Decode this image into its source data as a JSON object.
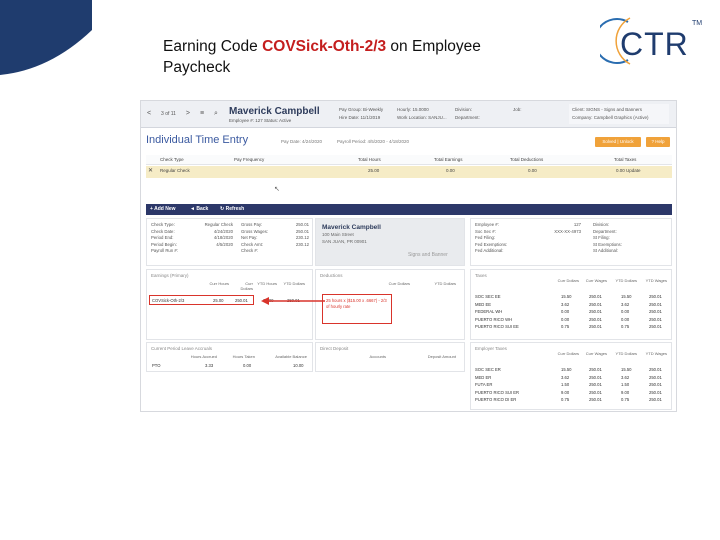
{
  "slide": {
    "title_prefix": "Earning Code ",
    "title_code": "COVSick-Oth-2/3",
    "title_suffix": " on Employee",
    "title_line2": "Paycheck"
  },
  "logo": {
    "text": "CTR",
    "tm": "TM"
  },
  "app": {
    "nav": {
      "prev": "<",
      "count": "3 of 11",
      "next": ">",
      "list": "≡",
      "search": "⌕"
    },
    "employee_name": "Maverick Campbell",
    "employee_sub": "Employee #: 127   Status: Active",
    "info_col1": [
      "Pay Group: Bi-Weekly",
      "Hire Date: 11/1/2019"
    ],
    "info_col2": [
      "Hourly: 15.0000",
      "Work Location: SANJU..."
    ],
    "info_col3": [
      "Division:",
      "Department:"
    ],
    "info_col4": [
      "Job:"
    ],
    "client": [
      "Client: SIGNS - Signs and Banners",
      "Company: Campbell Graphics (Active)"
    ],
    "heading": "Individual Time Entry",
    "pay_date": "Pay Date: 4/24/2020",
    "pay_period": "Payroll Period: 4/5/2020 - 4/18/2020",
    "btn_solved": "Solved | Unlock",
    "btn_help": "? Help",
    "grid_headers": [
      "Check Type",
      "Pay Frequency",
      "Total Hours",
      "Total Earnings",
      "Total Deductions",
      "Total Taxes"
    ],
    "grid_row": [
      "Regular Check",
      "",
      "25.00",
      "0.00",
      "0.00",
      "0.00  Update"
    ],
    "toolbar": [
      "+ Add New",
      "◄ Back",
      "↻ Refresh"
    ],
    "check_info_left": [
      "Check Type:",
      "Check Date:",
      "Period End:",
      "Period Begin:",
      "Payroll Run #:"
    ],
    "check_info_left_vals": [
      "Regular Check",
      "4/24/2020",
      "4/18/2020",
      "4/5/2020",
      ""
    ],
    "check_info_mid": [
      "Gross Pay:",
      "Gross Wages:",
      "Net Pay:",
      "Check Amt:",
      "Check #:"
    ],
    "check_info_mid_vals": [
      "250.01",
      "250.01",
      "230.12",
      "230.12",
      ""
    ],
    "addr_name": "Maverick Campbell",
    "addr_lines": [
      "100 Main Street",
      "SAN JUAN, PR 00901"
    ],
    "addr_banner": "Signs and Banner",
    "emp_labels": [
      "Employee #:",
      "Soc Sec #:",
      "Fed Filing:",
      "Fed Exemptions:",
      "Fed Additional:"
    ],
    "emp_vals": [
      "127",
      "XXX-XX-4973",
      "",
      "",
      ""
    ],
    "emp_labels2": [
      "Division:",
      "Department:",
      "St Filing:",
      "St Exemptions:",
      "St Additional:"
    ],
    "earn_title": "Earnings (Primary)",
    "earn_cols": [
      "Curr Hours",
      "Curr Dollars",
      "YTD Hours",
      "YTD Dollars"
    ],
    "earn_row": [
      "COVSick-Oth-2/3",
      "25.00",
      "250.01",
      "25.00",
      "250.01"
    ],
    "ded_title": "Deductions",
    "ded_cols": [
      "Curr Dollars",
      "YTD Dollars"
    ],
    "callout": "25 hours x ($15.00 x .6667) - 2/3 of hourly rate",
    "tax_title": "Taxes",
    "tax_cols": [
      "Curr Dollars",
      "Curr Wages",
      "YTD Dollars",
      "YTD Wages"
    ],
    "tax_rows": [
      [
        "SOC SEC EE",
        "15.50",
        "250.01",
        "15.50",
        "250.01"
      ],
      [
        "MED EE",
        "3.62",
        "250.01",
        "3.62",
        "250.01"
      ],
      [
        "FEDERAL WH",
        "0.00",
        "250.01",
        "0.00",
        "250.01"
      ],
      [
        "PUERTO RICO WH",
        "0.00",
        "250.01",
        "0.00",
        "250.01"
      ],
      [
        "PUERTO RICO SUI EE",
        "0.75",
        "250.01",
        "0.75",
        "250.01"
      ]
    ],
    "leave_title": "Current Period Leave Accruals",
    "leave_cols": [
      "Hours Accrued",
      "Hours Taken",
      "Available Balance"
    ],
    "leave_row": [
      "PTO",
      "3.33",
      "0.00",
      "10.00"
    ],
    "direct_title": "Direct Deposit",
    "direct_cols": [
      "Accounts",
      "Deposit Amount"
    ],
    "emptax_title": "Employer Taxes",
    "emptax_cols": [
      "Curr Dollars",
      "Curr Wages",
      "YTD Dollars",
      "YTD Wages"
    ],
    "emptax_rows": [
      [
        "SOC SEC ER",
        "15.50",
        "250.01",
        "15.50",
        "250.01"
      ],
      [
        "MED ER",
        "3.62",
        "250.01",
        "3.62",
        "250.01"
      ],
      [
        "FUTA ER",
        "1.50",
        "250.01",
        "1.50",
        "250.01"
      ],
      [
        "PUERTO RICO SUI ER",
        "9.00",
        "250.01",
        "9.00",
        "250.01"
      ],
      [
        "PUERTO RICO DI ER",
        "0.75",
        "250.01",
        "0.75",
        "250.01"
      ]
    ]
  },
  "colors": {
    "accent_red": "#c41e1e",
    "navy": "#2c3869",
    "orange": "#f0a23a",
    "logo_blue": "#1f3c6e"
  }
}
